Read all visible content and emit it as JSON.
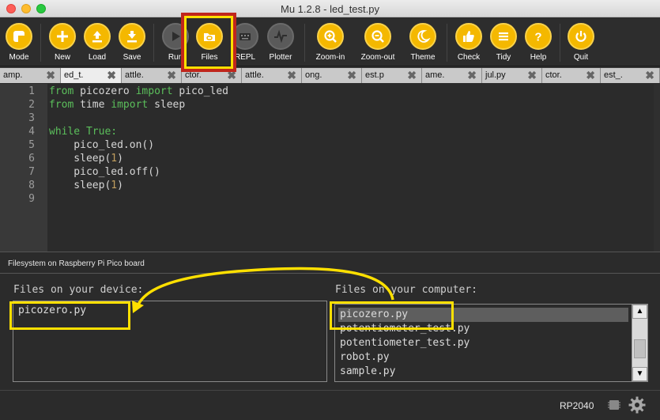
{
  "window": {
    "title": "Mu 1.2.8 - led_test.py"
  },
  "toolbar": {
    "buttons": [
      {
        "id": "mode",
        "label": "Mode",
        "icon": "mode-icon"
      },
      {
        "id": "new",
        "label": "New",
        "icon": "plus-icon"
      },
      {
        "id": "load",
        "label": "Load",
        "icon": "upload-icon"
      },
      {
        "id": "save",
        "label": "Save",
        "icon": "download-icon"
      },
      {
        "id": "run",
        "label": "Run",
        "icon": "play-icon"
      },
      {
        "id": "files",
        "label": "Files",
        "icon": "folder-icon"
      },
      {
        "id": "repl",
        "label": "REPL",
        "icon": "keyboard-icon"
      },
      {
        "id": "plotter",
        "label": "Plotter",
        "icon": "pulse-icon"
      },
      {
        "id": "zoom-in",
        "label": "Zoom-in",
        "icon": "zoom-in-icon"
      },
      {
        "id": "zoom-out",
        "label": "Zoom-out",
        "icon": "zoom-out-icon"
      },
      {
        "id": "theme",
        "label": "Theme",
        "icon": "moon-icon"
      },
      {
        "id": "check",
        "label": "Check",
        "icon": "thumbs-up-icon"
      },
      {
        "id": "tidy",
        "label": "Tidy",
        "icon": "lines-icon"
      },
      {
        "id": "help",
        "label": "Help",
        "icon": "question-icon"
      },
      {
        "id": "quit",
        "label": "Quit",
        "icon": "power-icon"
      }
    ]
  },
  "tabs": [
    {
      "label": "amp."
    },
    {
      "label": "ed_t."
    },
    {
      "label": "attle."
    },
    {
      "label": "ctor."
    },
    {
      "label": "attle."
    },
    {
      "label": "ong."
    },
    {
      "label": "est.p"
    },
    {
      "label": "ame."
    },
    {
      "label": "jul.py"
    },
    {
      "label": "ctor."
    },
    {
      "label": "est_."
    }
  ],
  "editor": {
    "line_numbers": [
      "1",
      "2",
      "3",
      "4",
      "5",
      "6",
      "7",
      "8",
      "9"
    ],
    "lines": {
      "l1_kw1": "from",
      "l1_mod": " picozero ",
      "l1_kw2": "import",
      "l1_name": " pico_led",
      "l2_kw1": "from",
      "l2_mod": " time ",
      "l2_kw2": "import",
      "l2_name": " sleep",
      "l4_kw": "while True:",
      "l5": "    pico_led.on()",
      "l6_a": "    sleep(",
      "l6_n": "1",
      "l6_b": ")",
      "l7": "    pico_led.off()",
      "l8_a": "    sleep(",
      "l8_n": "1",
      "l8_b": ")"
    }
  },
  "filesystem": {
    "title": "Filesystem on Raspberry Pi Pico board",
    "device_label": "Files on your device:",
    "computer_label": "Files on your computer:",
    "device_files": [
      "picozero.py"
    ],
    "computer_files": [
      "picozero.py",
      "potentiometer_test.py",
      "potentiometer_test.py",
      "robot.py",
      "sample.py"
    ],
    "selected_computer_file": "picozero.py"
  },
  "status": {
    "board": "RP2040",
    "icons": [
      "chip-icon",
      "gear-icon"
    ]
  },
  "annotation": {
    "highlight_color": "#ffe000",
    "outline_color": "#c0261c"
  }
}
